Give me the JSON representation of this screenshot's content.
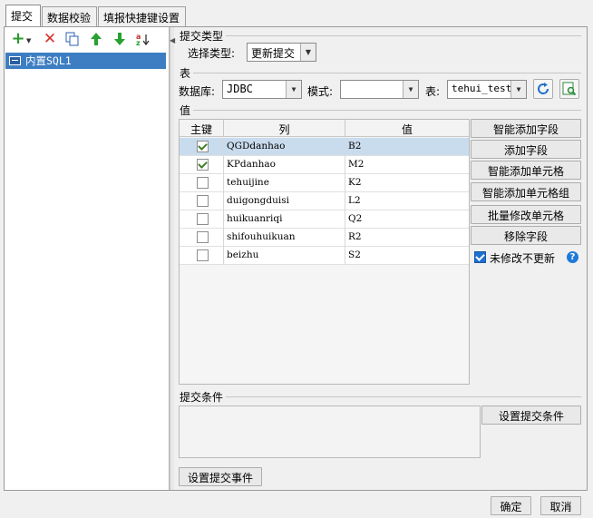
{
  "tabs": [
    {
      "label": "提交",
      "active": true
    },
    {
      "label": "数据校验",
      "active": false
    },
    {
      "label": "填报快捷键设置",
      "active": false
    }
  ],
  "left_toolbar": [
    "add-icon",
    "delete-icon",
    "copy-icon",
    "move-up-icon",
    "move-down-icon",
    "sort-icon"
  ],
  "tree": {
    "item": "内置SQL1"
  },
  "submit_type": {
    "section": "提交类型",
    "label": "选择类型:",
    "value": "更新提交"
  },
  "table_section": {
    "section": "表",
    "db_label": "数据库:",
    "db_value": "JDBC",
    "schema_label": "模式:",
    "schema_value": "",
    "table_label": "表:",
    "table_value": "tehui_test"
  },
  "values": {
    "section": "值",
    "headers": {
      "key": "主键",
      "col": "列",
      "val": "值"
    },
    "rows": [
      {
        "key": true,
        "col": "QGDdanhao",
        "val": "B2",
        "selected": true
      },
      {
        "key": true,
        "col": "KPdanhao",
        "val": "M2",
        "selected": false
      },
      {
        "key": false,
        "col": "tehuijine",
        "val": "K2",
        "selected": false
      },
      {
        "key": false,
        "col": "duigongduisi",
        "val": "L2",
        "selected": false
      },
      {
        "key": false,
        "col": "huikuanriqi",
        "val": "Q2",
        "selected": false
      },
      {
        "key": false,
        "col": "shifouhuikuan",
        "val": "R2",
        "selected": false
      },
      {
        "key": false,
        "col": "beizhu",
        "val": "S2",
        "selected": false
      }
    ],
    "buttons": {
      "smart_add_field": "智能添加字段",
      "add_field": "添加字段",
      "smart_add_cell": "智能添加单元格",
      "smart_add_cell_group": "智能添加单元格组",
      "batch_edit_cell": "批量修改单元格",
      "remove_field": "移除字段"
    },
    "no_update_unmodified": {
      "label": "未修改不更新",
      "checked": true
    }
  },
  "condition": {
    "section": "提交条件",
    "set_button": "设置提交条件"
  },
  "event_button": "设置提交事件",
  "footer": {
    "ok": "确定",
    "cancel": "取消"
  },
  "colors": {
    "selection": "#3d7ec3",
    "row_selected": "#c9dcee",
    "accent": "#1e6fd0"
  }
}
